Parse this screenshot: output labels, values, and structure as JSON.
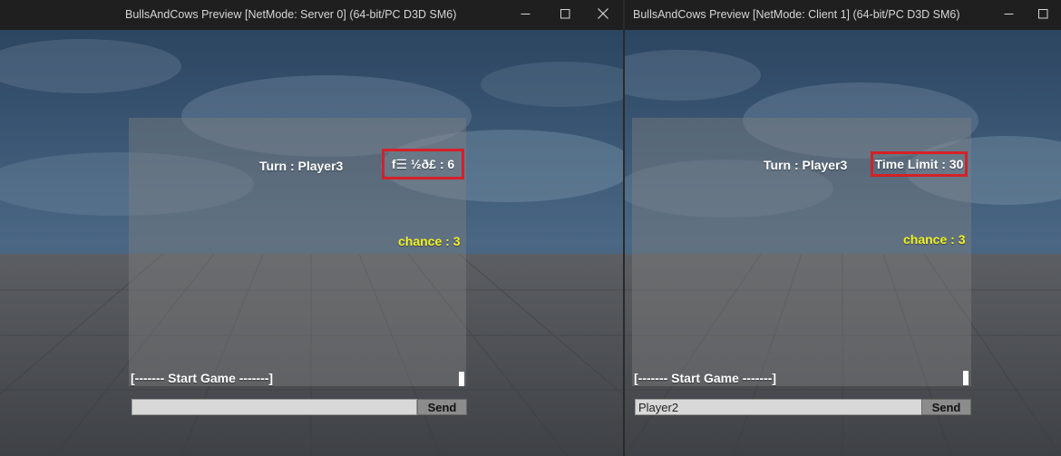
{
  "server_window": {
    "title": "BullsAndCows Preview [NetMode: Server 0]  (64-bit/PC D3D SM6)",
    "turn_text": "Turn : Player3",
    "time_limit_text": "f☰ ½ð£ : 6",
    "chance_text": "chance : 3",
    "chat_log_text": "[------- Start Game -------]",
    "chat_input_value": "",
    "send_label": "Send",
    "controls": {
      "minimize": "minimize-icon",
      "maximize": "maximize-icon",
      "close": "close-icon"
    }
  },
  "client_window": {
    "title": "BullsAndCows Preview [NetMode: Client 1]  (64-bit/PC D3D SM6)",
    "turn_text": "Turn : Player3",
    "time_limit_text": "Time Limit : 30",
    "chance_text": "chance : 3",
    "chat_log_text": "[------- Start Game -------]",
    "chat_input_value": "Player2",
    "send_label": "Send",
    "controls": {
      "minimize": "minimize-icon",
      "maximize": "maximize-icon"
    }
  },
  "colors": {
    "highlight_border": "#d42127",
    "chance_text": "#f2f224",
    "hud_text": "#ffffff"
  }
}
